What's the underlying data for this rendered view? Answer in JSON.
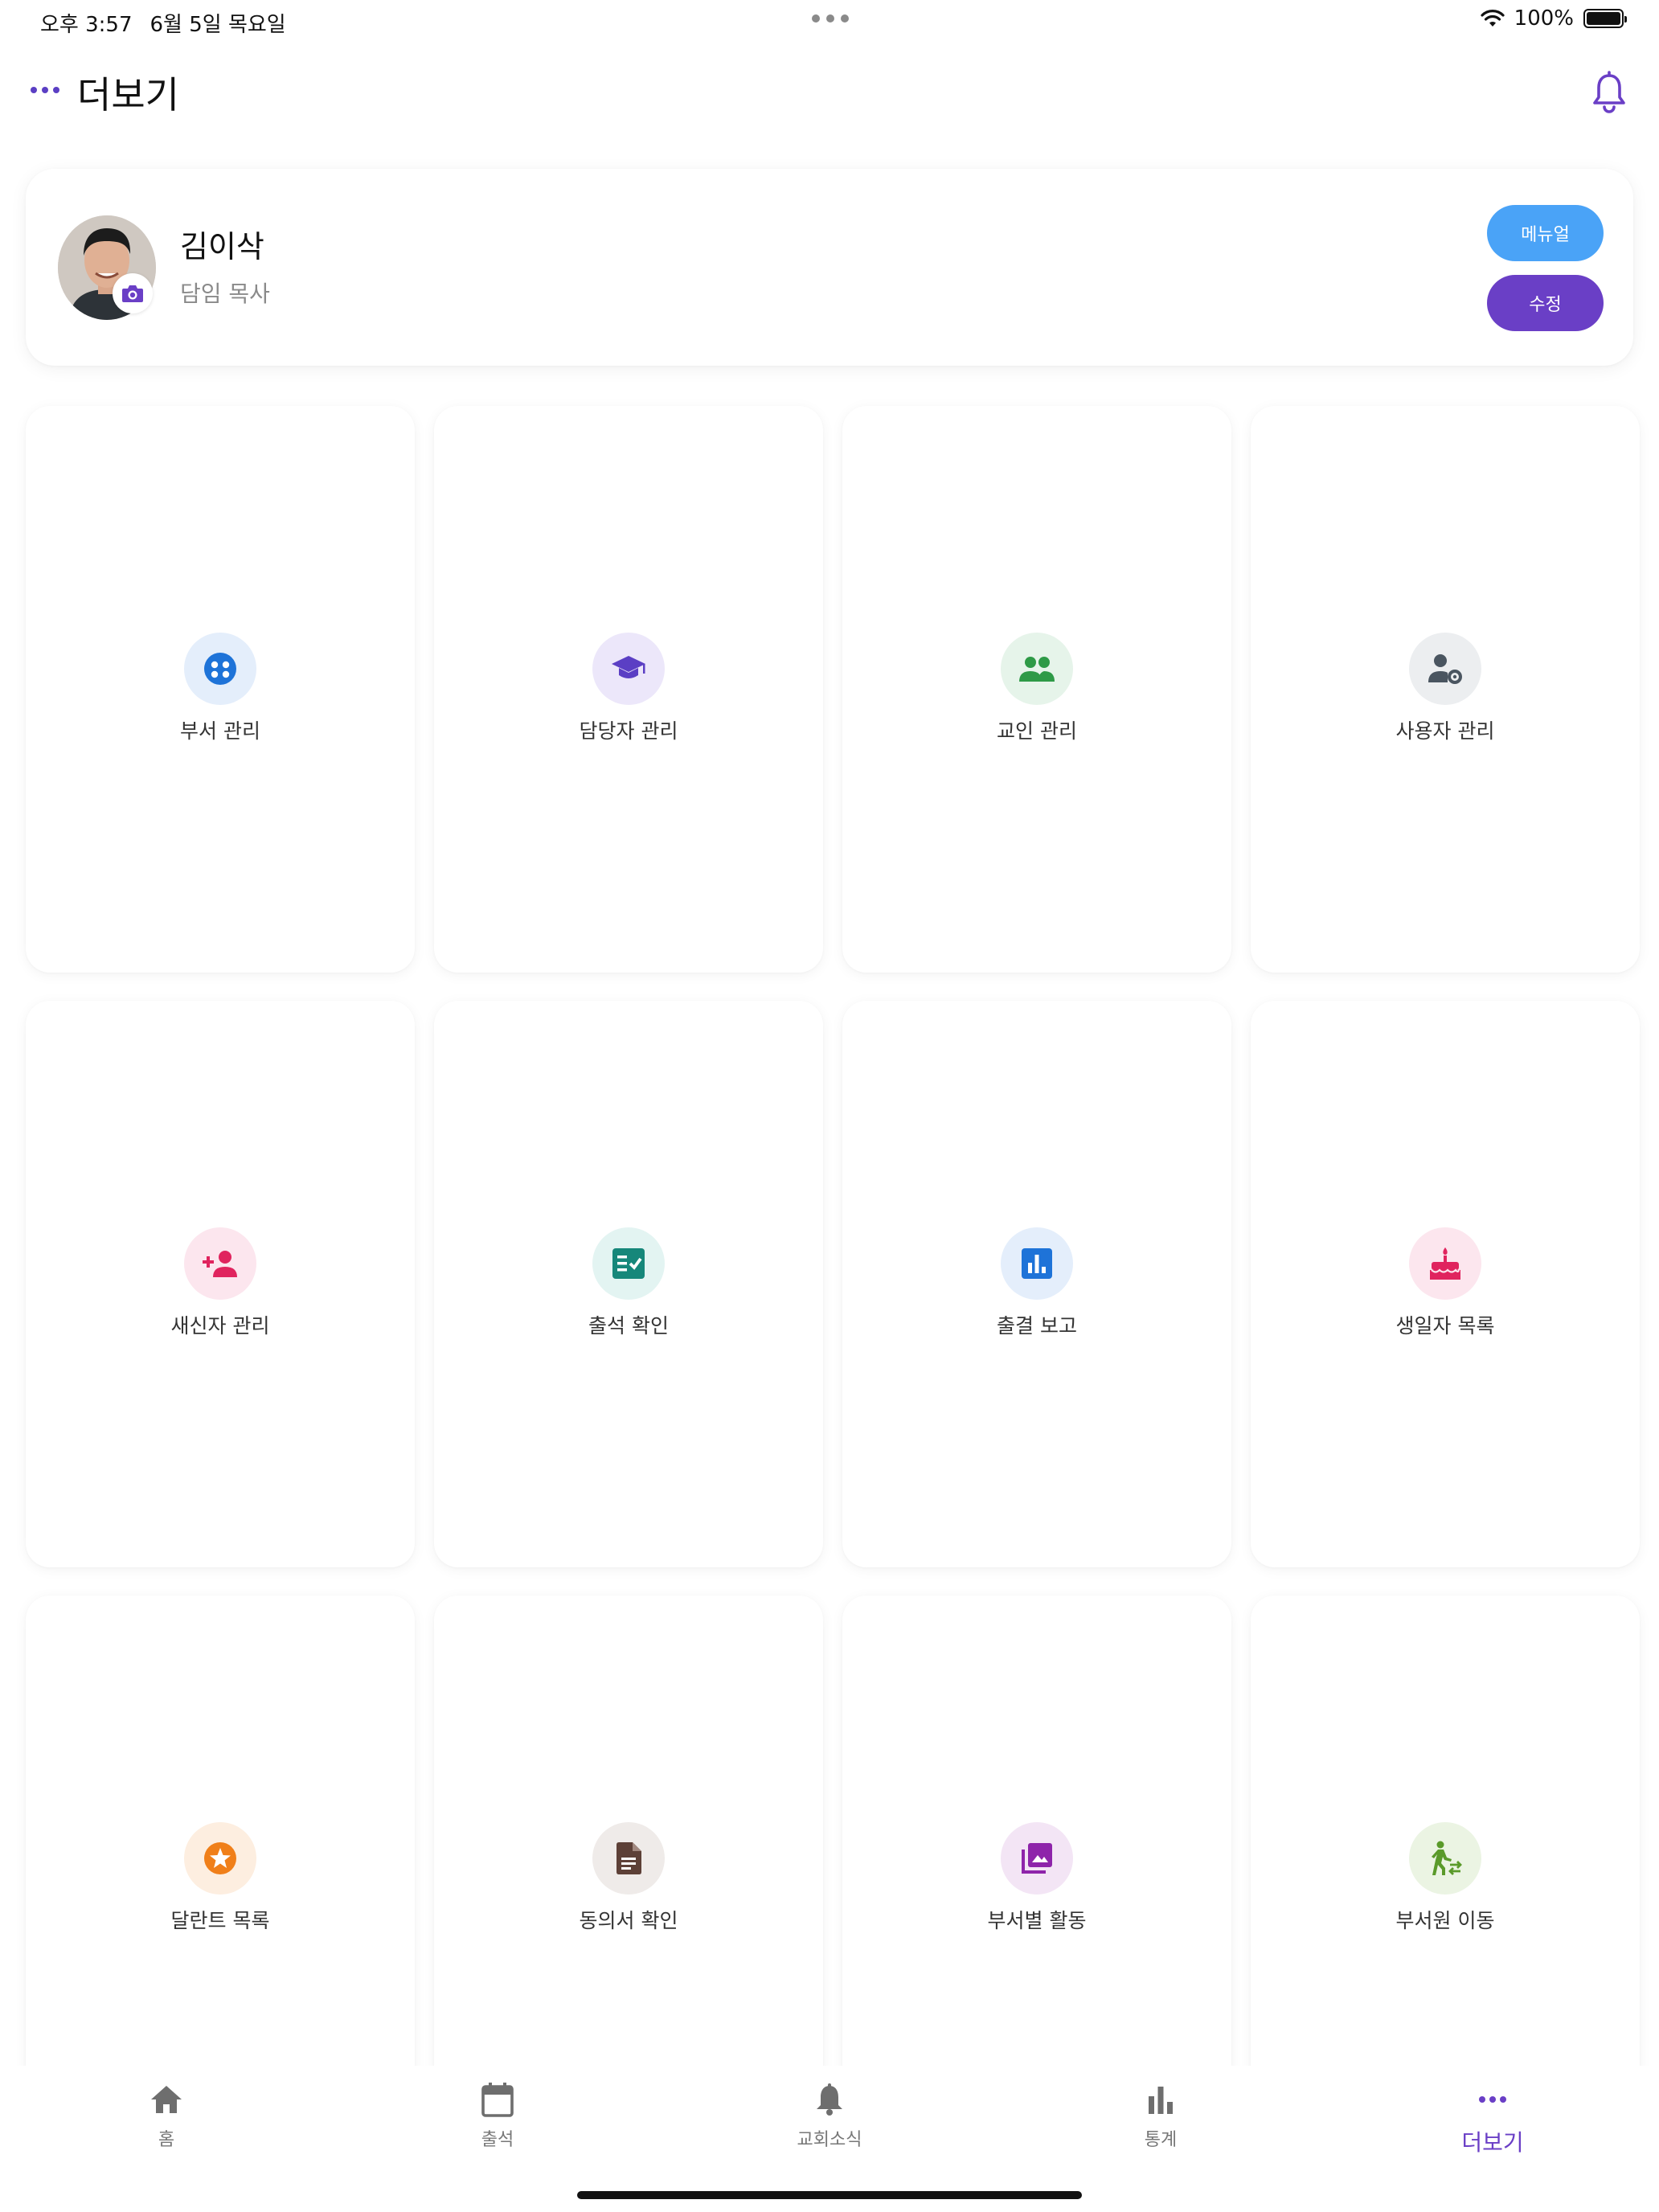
{
  "status_bar": {
    "time": "오후 3:57",
    "date": "6월 5일 목요일",
    "battery_text": "100%"
  },
  "header": {
    "title": "더보기"
  },
  "profile": {
    "name": "김이삭",
    "role": "담임 목사",
    "manual_button": "메뉴얼",
    "edit_button": "수정"
  },
  "tiles": [
    {
      "label": "부서 관리",
      "icon": "groups-circle-icon",
      "color": "#1e73d8",
      "bg": "#e4eefb"
    },
    {
      "label": "담당자 관리",
      "icon": "graduation-cap-icon",
      "color": "#5b3fc4",
      "bg": "#ece7fa"
    },
    {
      "label": "교인 관리",
      "icon": "people-icon",
      "color": "#2e9a47",
      "bg": "#e6f4ea"
    },
    {
      "label": "사용자 관리",
      "icon": "user-settings-icon",
      "color": "#4a5560",
      "bg": "#eceef0"
    },
    {
      "label": "새신자 관리",
      "icon": "person-add-icon",
      "color": "#e0245e",
      "bg": "#fce6ee"
    },
    {
      "label": "출석 확인",
      "icon": "checklist-icon",
      "color": "#16877a",
      "bg": "#e3f4f2"
    },
    {
      "label": "출결 보고",
      "icon": "bar-chart-box-icon",
      "color": "#1e73d8",
      "bg": "#e4eefb"
    },
    {
      "label": "생일자 목록",
      "icon": "cake-icon",
      "color": "#e0245e",
      "bg": "#fce6ee"
    },
    {
      "label": "달란트 목록",
      "icon": "star-badge-icon",
      "color": "#f07f19",
      "bg": "#fdeee0"
    },
    {
      "label": "동의서 확인",
      "icon": "document-icon",
      "color": "#5d4037",
      "bg": "#efebe9"
    },
    {
      "label": "부서별 활동",
      "icon": "photo-library-icon",
      "color": "#8e24aa",
      "bg": "#f3e5f5"
    },
    {
      "label": "부서원 이동",
      "icon": "transfer-walk-icon",
      "color": "#5a9a2a",
      "bg": "#ebf4e3"
    }
  ],
  "bottom_nav": [
    {
      "label": "홈",
      "icon": "home-icon"
    },
    {
      "label": "출석",
      "icon": "calendar-icon"
    },
    {
      "label": "교회소식",
      "icon": "bell-icon"
    },
    {
      "label": "통계",
      "icon": "bar-chart-icon"
    },
    {
      "label": "더보기",
      "icon": "more-dots-icon",
      "active": true
    }
  ],
  "colors": {
    "accent": "#6a3fc6",
    "manual_button": "#4aa3f7"
  }
}
